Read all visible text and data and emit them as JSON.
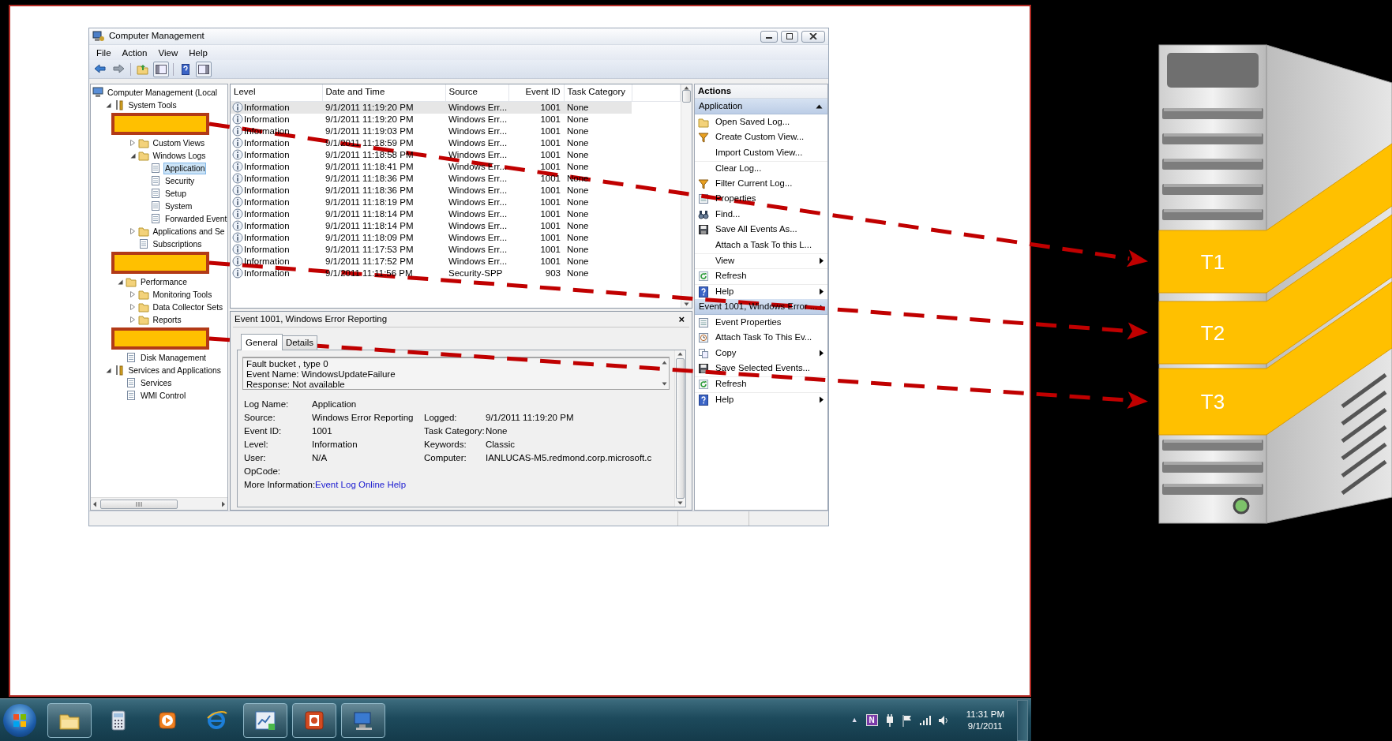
{
  "window": {
    "title": "Computer Management"
  },
  "menu": [
    "File",
    "Action",
    "View",
    "Help"
  ],
  "tree": [
    {
      "kind": "item",
      "label": "Computer Management (Local",
      "selected": false,
      "children": [
        {
          "kind": "item",
          "label": "System Tools",
          "selected": false,
          "expanded": true,
          "children": [
            {
              "kind": "redaction",
              "children": [
                {
                  "kind": "item",
                  "label": "Custom Views",
                  "selected": false,
                  "expanded": false
                },
                {
                  "kind": "item",
                  "label": "Windows Logs",
                  "selected": false,
                  "expanded": true,
                  "children": [
                    {
                      "kind": "item",
                      "label": "Application",
                      "selected": true
                    },
                    {
                      "kind": "item",
                      "label": "Security",
                      "selected": false
                    },
                    {
                      "kind": "item",
                      "label": "Setup",
                      "selected": false
                    },
                    {
                      "kind": "item",
                      "label": "System",
                      "selected": false
                    },
                    {
                      "kind": "item",
                      "label": "Forwarded Event",
                      "selected": false
                    }
                  ]
                },
                {
                  "kind": "item",
                  "label": "Applications and Se",
                  "selected": false,
                  "expanded": false
                },
                {
                  "kind": "item",
                  "label": "Subscriptions",
                  "selected": false
                }
              ]
            },
            {
              "kind": "redaction"
            },
            {
              "kind": "item",
              "label": "Performance",
              "selected": false,
              "expanded": true,
              "children": [
                {
                  "kind": "item",
                  "label": "Monitoring Tools",
                  "selected": false,
                  "expanded": false
                },
                {
                  "kind": "item",
                  "label": "Data Collector Sets",
                  "selected": false,
                  "expanded": false
                },
                {
                  "kind": "item",
                  "label": "Reports",
                  "selected": false,
                  "expanded": false
                }
              ]
            }
          ]
        },
        {
          "kind": "redaction",
          "children": [
            {
              "kind": "item",
              "label": "Disk Management",
              "selected": false
            }
          ]
        },
        {
          "kind": "item",
          "label": "Services and Applications",
          "selected": false,
          "expanded": true,
          "children": [
            {
              "kind": "item",
              "label": "Services",
              "selected": false
            },
            {
              "kind": "item",
              "label": "WMI Control",
              "selected": false
            }
          ]
        }
      ]
    }
  ],
  "events": {
    "columns": [
      "Level",
      "Date and Time",
      "Source",
      "Event ID",
      "Task Category"
    ],
    "rows": [
      {
        "cells": [
          "Information",
          "9/1/2011 11:19:20 PM",
          "Windows Err...",
          "1001",
          "None"
        ],
        "selected": true
      },
      {
        "cells": [
          "Information",
          "9/1/2011 11:19:20 PM",
          "Windows Err...",
          "1001",
          "None"
        ],
        "selected": false
      },
      {
        "cells": [
          "Information",
          "9/1/2011 11:19:03 PM",
          "Windows Err...",
          "1001",
          "None"
        ],
        "selected": false
      },
      {
        "cells": [
          "Information",
          "9/1/2011 11:18:59 PM",
          "Windows Err...",
          "1001",
          "None"
        ],
        "selected": false
      },
      {
        "cells": [
          "Information",
          "9/1/2011 11:18:58 PM",
          "Windows Err...",
          "1001",
          "None"
        ],
        "selected": false
      },
      {
        "cells": [
          "Information",
          "9/1/2011 11:18:41 PM",
          "Windows Err...",
          "1001",
          "None"
        ],
        "selected": false
      },
      {
        "cells": [
          "Information",
          "9/1/2011 11:18:36 PM",
          "Windows Err...",
          "1001",
          "None"
        ],
        "selected": false
      },
      {
        "cells": [
          "Information",
          "9/1/2011 11:18:36 PM",
          "Windows Err...",
          "1001",
          "None"
        ],
        "selected": false
      },
      {
        "cells": [
          "Information",
          "9/1/2011 11:18:19 PM",
          "Windows Err...",
          "1001",
          "None"
        ],
        "selected": false
      },
      {
        "cells": [
          "Information",
          "9/1/2011 11:18:14 PM",
          "Windows Err...",
          "1001",
          "None"
        ],
        "selected": false
      },
      {
        "cells": [
          "Information",
          "9/1/2011 11:18:14 PM",
          "Windows Err...",
          "1001",
          "None"
        ],
        "selected": false
      },
      {
        "cells": [
          "Information",
          "9/1/2011 11:18:09 PM",
          "Windows Err...",
          "1001",
          "None"
        ],
        "selected": false
      },
      {
        "cells": [
          "Information",
          "9/1/2011 11:17:53 PM",
          "Windows Err...",
          "1001",
          "None"
        ],
        "selected": false
      },
      {
        "cells": [
          "Information",
          "9/1/2011 11:17:52 PM",
          "Windows Err...",
          "1001",
          "None"
        ],
        "selected": false
      },
      {
        "cells": [
          "Information",
          "9/1/2011 11:11:56 PM",
          "Security-SPP",
          "903",
          "None"
        ],
        "selected": false
      }
    ]
  },
  "event_detail": {
    "title": "Event 1001, Windows Error Reporting",
    "close": "×",
    "tabs": [
      {
        "label": "General",
        "selected": true
      },
      {
        "label": "Details",
        "selected": false
      }
    ],
    "description": [
      "Fault bucket , type 0",
      "Event Name: WindowsUpdateFailure",
      "Response: Not available"
    ],
    "fields": [
      {
        "label": "Log Name:",
        "value": "Application"
      },
      {
        "label": "Source:",
        "value": "Windows Error Reporting",
        "label_2": "Logged:",
        "value_2": "9/1/2011 11:19:20 PM"
      },
      {
        "label": "Event ID:",
        "value": "1001",
        "label_2": "Task Category:",
        "value_2": "None"
      },
      {
        "label": "Level:",
        "value": "Information",
        "label_2": "Keywords:",
        "value_2": "Classic"
      },
      {
        "label": "User:",
        "value": "N/A",
        "label_2": "Computer:",
        "value_2": "IANLUCAS-M5.redmond.corp.microsoft.c"
      },
      {
        "label": "OpCode:"
      },
      {
        "label": "More Information:",
        "link": "Event Log Online Help"
      }
    ]
  },
  "actions": {
    "title": "Actions",
    "sections": [
      {
        "title": "Application",
        "expanded": true,
        "items": [
          {
            "label": "Open Saved Log...",
            "submenu": false,
            "divider_above": false
          },
          {
            "label": "Create Custom View...",
            "submenu": false,
            "divider_above": false
          },
          {
            "label": "Import Custom View...",
            "submenu": false,
            "divider_above": false
          },
          {
            "label": "Clear Log...",
            "submenu": false,
            "divider_above": true
          },
          {
            "label": "Filter Current Log...",
            "submenu": false,
            "divider_above": false
          },
          {
            "label": "Properties",
            "submenu": false,
            "divider_above": false
          },
          {
            "label": "Find...",
            "submenu": false,
            "divider_above": false
          },
          {
            "label": "Save All Events As...",
            "submenu": false,
            "divider_above": false
          },
          {
            "label": "Attach a Task To this L...",
            "submenu": false,
            "divider_above": false
          },
          {
            "label": "View",
            "submenu": true,
            "divider_above": true
          },
          {
            "label": "Refresh",
            "submenu": false,
            "divider_above": true
          },
          {
            "label": "Help",
            "submenu": true,
            "divider_above": true
          }
        ]
      },
      {
        "title": "Event 1001, Windows Error ...",
        "expanded": true,
        "items": [
          {
            "label": "Event Properties",
            "submenu": false,
            "divider_above": false
          },
          {
            "label": "Attach Task To This Ev...",
            "submenu": false,
            "divider_above": false
          },
          {
            "label": "Copy",
            "submenu": true,
            "divider_above": false
          },
          {
            "label": "Save Selected Events...",
            "submenu": false,
            "divider_above": false
          },
          {
            "label": "Refresh",
            "submenu": false,
            "divider_above": true
          },
          {
            "label": "Help",
            "submenu": true,
            "divider_above": true
          }
        ]
      }
    ]
  },
  "diagram": {
    "tiers": [
      "T1",
      "T2",
      "T3"
    ]
  },
  "taskbar": {
    "apps": [
      {
        "running": true
      },
      {
        "running": false
      },
      {
        "running": false
      },
      {
        "running": false
      },
      {
        "running": true
      },
      {
        "running": true
      },
      {
        "running": true
      }
    ],
    "tray_expand": "▲",
    "note_badge": "N",
    "time": "11:31 PM",
    "date": "9/1/2011"
  }
}
